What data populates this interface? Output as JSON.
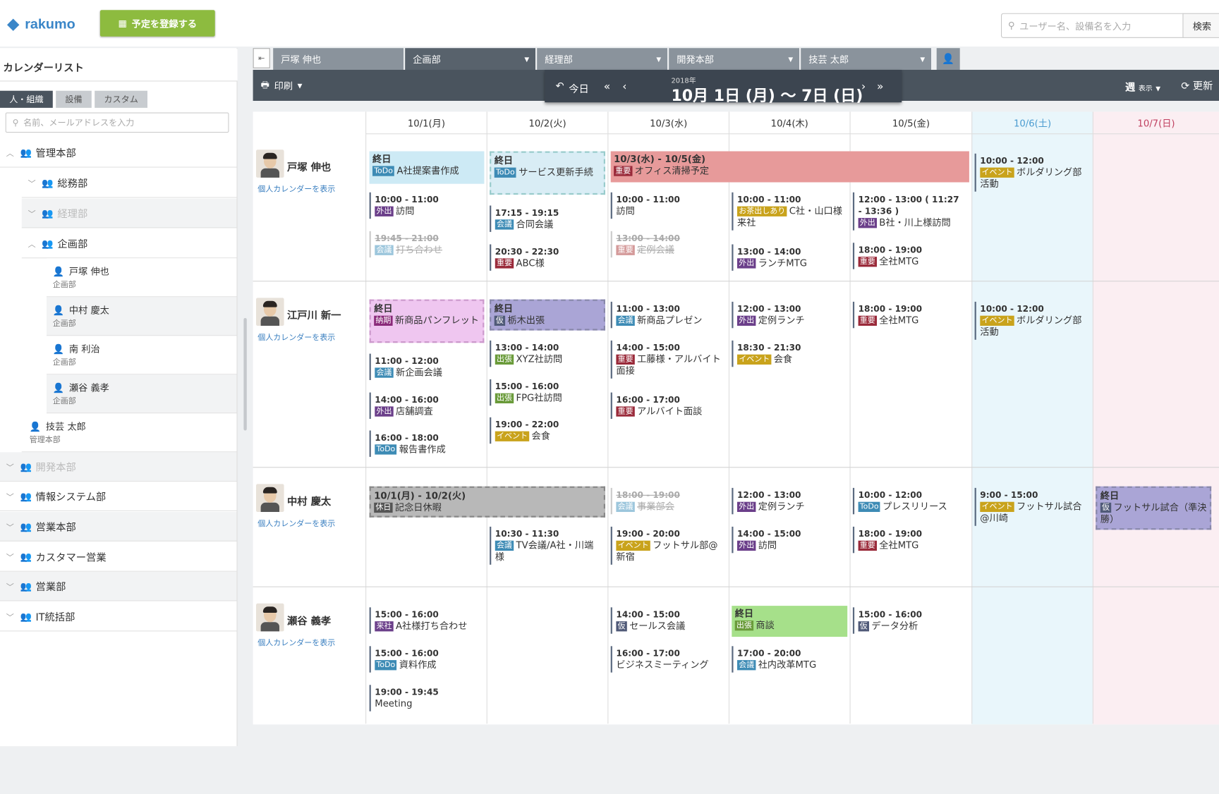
{
  "app": {
    "logo": "rakumo",
    "register_button": "予定を登録する",
    "search_placeholder": "ユーザー名、設備名を入力",
    "search_button": "検索"
  },
  "sidebar": {
    "title": "カレンダーリスト",
    "tabs": [
      "人・組織",
      "設備",
      "カスタム"
    ],
    "search_placeholder": "名前、メールアドレスを入力",
    "nodes": [
      "管理本部",
      "総務部",
      "経理部",
      "企画部",
      "技芸 太郎",
      "開発本部",
      "情報システム部",
      "営業本部",
      "カスタマー営業",
      "営業部",
      "IT統括部"
    ],
    "node_org": {
      "gigei": "管理本部"
    },
    "people": [
      {
        "name": "戸塚 伸也",
        "org": "企画部"
      },
      {
        "name": "中村 慶太",
        "org": "企画部"
      },
      {
        "name": "南 利治",
        "org": "企画部"
      },
      {
        "name": "瀬谷 義孝",
        "org": "企画部"
      }
    ]
  },
  "user_tabs": [
    "戸塚 伸也",
    "企画部",
    "経理部",
    "開発本部",
    "技芸 太郎"
  ],
  "toolbar": {
    "print": "印刷",
    "today": "今日",
    "year": "2018年",
    "range_main": "10月 1日 (月) ～ 7日 (日)",
    "week": "週",
    "week_sub": "表示",
    "refresh": "更新"
  },
  "days": [
    "10/1(月)",
    "10/2(火)",
    "10/3(水)",
    "10/4(木)",
    "10/5(金)",
    "10/6(土)",
    "10/7(日)"
  ],
  "colors": {
    "todo": "#3d8bb5",
    "gaishutsu": "#6b3f8a",
    "kaigi": "#3d8bb5",
    "juyo": "#9a2a3a",
    "event": "#c9a31c",
    "shucchou": "#6a9b3a",
    "kari": "#505a78",
    "nouki": "#8a2a7a",
    "raisha": "#6b3f8a",
    "ocha": "#c9a31c",
    "kyuka": "#555555"
  },
  "users": [
    {
      "name": "戸塚 伸也",
      "pcal": "個人カレンダーを表示"
    },
    {
      "name": "江戸川 新一",
      "pcal": "個人カレンダーを表示"
    },
    {
      "name": "中村 慶太",
      "pcal": "個人カレンダーを表示"
    },
    {
      "name": "瀬谷 義孝",
      "pcal": "個人カレンダーを表示"
    }
  ],
  "events": {
    "u0": [
      {
        "time": "終日",
        "tag": "ToDo",
        "title": "A社提案書作成"
      },
      {
        "time": "終日",
        "tag": "ToDo",
        "title": "サービス更新手続"
      },
      {
        "time": "10/3(水) - 10/5(金)",
        "tag": "重要",
        "title": "オフィス清掃予定"
      },
      {
        "time": "10:00 - 11:00",
        "tag": "外出",
        "title": "訪問"
      },
      {
        "time": "19:45 - 21:00",
        "tag": "会議",
        "title": "打ち合わせ"
      },
      {
        "time": "17:15 - 19:15",
        "tag": "会議",
        "title": "合同会議"
      },
      {
        "time": "20:30 - 22:30",
        "tag": "重要",
        "title": "ABC様"
      },
      {
        "time": "10:00 - 11:00",
        "tag": "",
        "title": "訪問"
      },
      {
        "time": "13:00 - 14:00",
        "tag": "重要",
        "title": "定例会議"
      },
      {
        "time": "10:00 - 11:00",
        "tag": "お茶出しあり",
        "title": "C社・山口様来社"
      },
      {
        "time": "13:00 - 14:00",
        "tag": "外出",
        "title": "ランチMTG"
      },
      {
        "time": "12:00 - 13:00 ( 11:27 - 13:36 )",
        "tag": "外出",
        "title": "B社・川上様訪問"
      },
      {
        "time": "18:00 - 19:00",
        "tag": "重要",
        "title": "全社MTG"
      },
      {
        "time": "10:00 - 12:00",
        "tag": "イベント",
        "title": "ボルダリング部活動"
      }
    ],
    "u1": [
      {
        "time": "終日",
        "tag": "納期",
        "title": "新商品パンフレット"
      },
      {
        "time": "終日",
        "tag": "仮",
        "title": "栃木出張"
      },
      {
        "time": "11:00 - 13:00",
        "tag": "会議",
        "title": "新商品プレゼン"
      },
      {
        "time": "12:00 - 13:00",
        "tag": "外出",
        "title": "定例ランチ"
      },
      {
        "time": "18:00 - 19:00",
        "tag": "重要",
        "title": "全社MTG"
      },
      {
        "time": "10:00 - 12:00",
        "tag": "イベント",
        "title": "ボルダリング部活動"
      },
      {
        "time": "11:00 - 12:00",
        "tag": "会議",
        "title": "新企画会議"
      },
      {
        "time": "13:00 - 14:00",
        "tag": "出張",
        "title": "XYZ社訪問"
      },
      {
        "time": "14:00 - 15:00",
        "tag": "重要",
        "title": "工藤様・アルバイト面接"
      },
      {
        "time": "18:30 - 21:30",
        "tag": "イベント",
        "title": "会食"
      },
      {
        "time": "14:00 - 16:00",
        "tag": "外出",
        "title": "店舗調査"
      },
      {
        "time": "15:00 - 16:00",
        "tag": "出張",
        "title": "FPG社訪問"
      },
      {
        "time": "16:00 - 17:00",
        "tag": "重要",
        "title": "アルバイト面談"
      },
      {
        "time": "16:00 - 18:00",
        "tag": "ToDo",
        "title": "報告書作成"
      },
      {
        "time": "19:00 - 22:00",
        "tag": "イベント",
        "title": "会食"
      }
    ],
    "u2": [
      {
        "time": "10/1(月) - 10/2(火)",
        "tag": "休日",
        "title": "記念日休暇"
      },
      {
        "time": "18:00 - 19:00",
        "tag": "会議",
        "title": "事業部会"
      },
      {
        "time": "12:00 - 13:00",
        "tag": "外出",
        "title": "定例ランチ"
      },
      {
        "time": "10:00 - 12:00",
        "tag": "ToDo",
        "title": "プレスリリース"
      },
      {
        "time": "9:00 - 15:00",
        "tag": "イベント",
        "title": "フットサル試合@川崎"
      },
      {
        "time": "終日",
        "tag": "仮",
        "title": "フットサル試合（準決勝）"
      },
      {
        "time": "10:30 - 11:30",
        "tag": "会議",
        "title": "TV会議/A社・川端様"
      },
      {
        "time": "19:00 - 20:00",
        "tag": "イベント",
        "title": "フットサル部@新宿"
      },
      {
        "time": "14:00 - 15:00",
        "tag": "外出",
        "title": "訪問"
      },
      {
        "time": "18:00 - 19:00",
        "tag": "重要",
        "title": "全社MTG"
      }
    ],
    "u3": [
      {
        "time": "15:00 - 16:00",
        "tag": "来社",
        "title": "A社様打ち合わせ"
      },
      {
        "time": "14:00 - 15:00",
        "tag": "仮",
        "title": "セールス会議"
      },
      {
        "time": "終日",
        "tag": "出張",
        "title": "商談"
      },
      {
        "time": "15:00 - 16:00",
        "tag": "仮",
        "title": "データ分析"
      },
      {
        "time": "15:00 - 16:00",
        "tag": "ToDo",
        "title": "資料作成"
      },
      {
        "time": "16:00 - 17:00",
        "tag": "",
        "title": "ビジネスミーティング"
      },
      {
        "time": "17:00 - 20:00",
        "tag": "会議",
        "title": "社内改革MTG"
      },
      {
        "time": "19:00 - 19:45",
        "tag": "",
        "title": "Meeting"
      }
    ]
  }
}
